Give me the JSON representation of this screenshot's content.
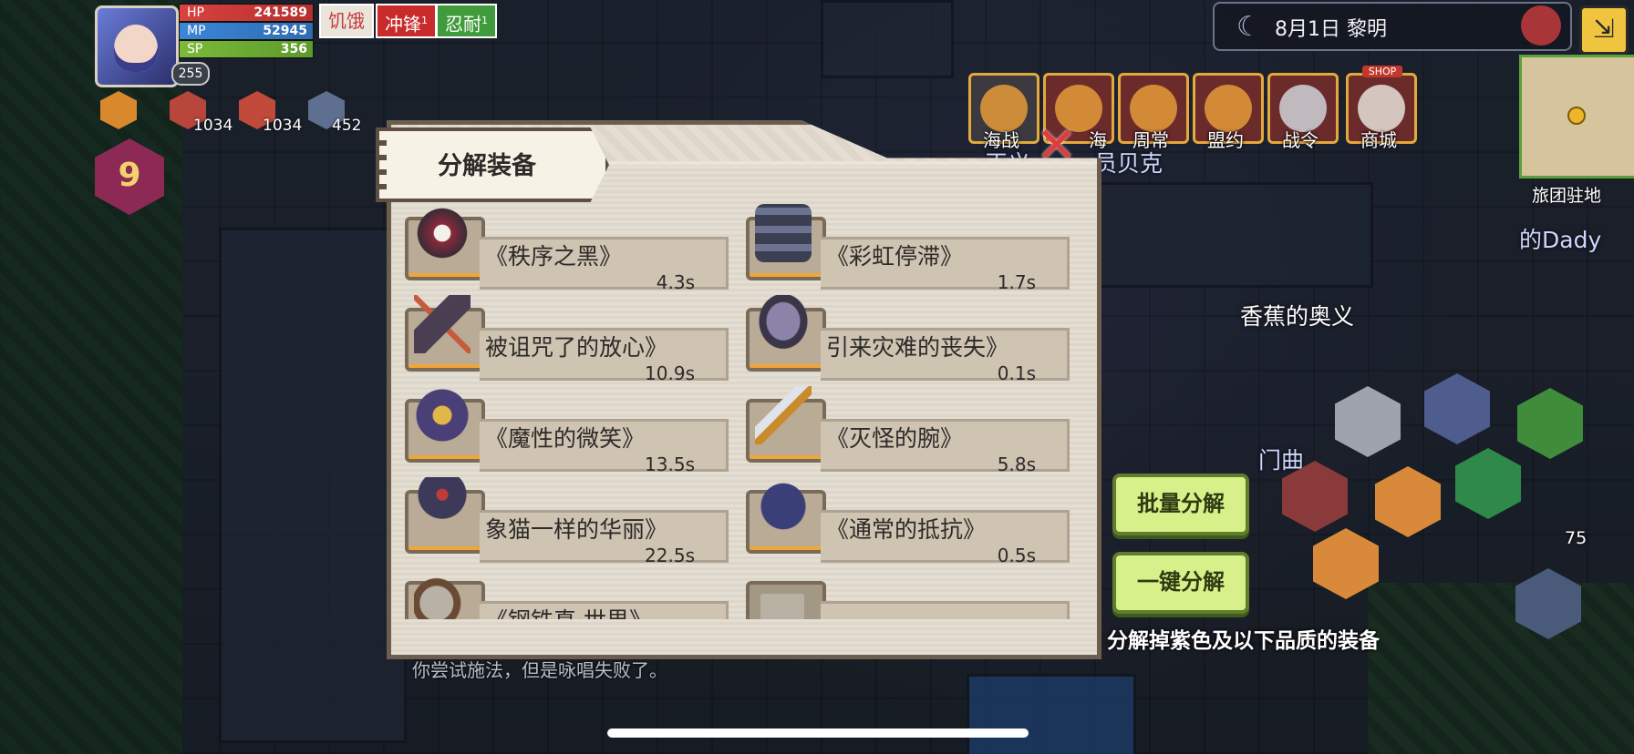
{
  "player": {
    "level": "255",
    "hp_label": "HP",
    "hp_value": "241589",
    "mp_label": "MP",
    "mp_value": "52945",
    "sp_label": "SP",
    "sp_value": "356"
  },
  "status_tags": [
    {
      "label": "饥饿",
      "count": ""
    },
    {
      "label": "冲锋",
      "count": "1"
    },
    {
      "label": "忍耐",
      "count": "1"
    }
  ],
  "buffs": [
    {
      "icon": "buff-hammer-icon",
      "value": ""
    },
    {
      "icon": "buff-attack-icon",
      "value": "1034"
    },
    {
      "icon": "buff-run-icon",
      "value": "1034"
    },
    {
      "icon": "buff-shield-icon",
      "value": "452"
    }
  ],
  "stack_count": "9",
  "time": {
    "date_text": "8月1日   黎明"
  },
  "top_menu": [
    {
      "label": "海战",
      "icon": "ship-icon"
    },
    {
      "label": "海",
      "icon": "captain-icon"
    },
    {
      "label": "周常",
      "icon": "weekly-icon"
    },
    {
      "label": "盟约",
      "icon": "pact-icon"
    },
    {
      "label": "战令",
      "icon": "eagle-icon"
    },
    {
      "label": "商城",
      "icon": "shop-icon"
    }
  ],
  "shop_sign": "SHOP",
  "minimap_label": "旅团驻地",
  "npcs": {
    "npc1": "正义",
    "npc1b": "员贝克",
    "npc2": "香蕉的奥义",
    "npc3": "的Dady",
    "npc4": "门曲"
  },
  "dialog": {
    "title": "分解装备",
    "items": [
      {
        "name": "《秩序之黑》",
        "time": "4.3s",
        "icon": "dark-shield-icon"
      },
      {
        "name": "《彩虹停滞》",
        "time": "1.7s",
        "icon": "pipes-icon"
      },
      {
        "name": "被诅咒了的放心》",
        "time": "10.9s",
        "icon": "hammer-icon"
      },
      {
        "name": "引来灾难的丧失》",
        "time": "0.1s",
        "icon": "gauntlet-icon"
      },
      {
        "name": "《魔性的微笑》",
        "time": "13.5s",
        "icon": "demon-mask-icon"
      },
      {
        "name": "《灭怪的腕》",
        "time": "5.8s",
        "icon": "dagger-icon"
      },
      {
        "name": "象猫一样的华丽》",
        "time": "22.5s",
        "icon": "armor-icon"
      },
      {
        "name": "《通常的抵抗》",
        "time": "0.5s",
        "icon": "vest-icon"
      },
      {
        "name": "《钢铁真·世界》",
        "time": "",
        "icon": "boots-icon"
      },
      {
        "name": "",
        "time": "",
        "icon": ""
      }
    ]
  },
  "hint": "你尝试施法，但是咏唱失败了。",
  "buttons": {
    "bulk_decompose": "批量分解",
    "one_click_decompose": "一键分解"
  },
  "caption": "分解掉紫色及以下品质的装备",
  "skill_count": "75",
  "colors": {
    "panel_bg": "#eae4da",
    "button_green": "#d8f08a",
    "slot_orange": "#f0a63a"
  }
}
